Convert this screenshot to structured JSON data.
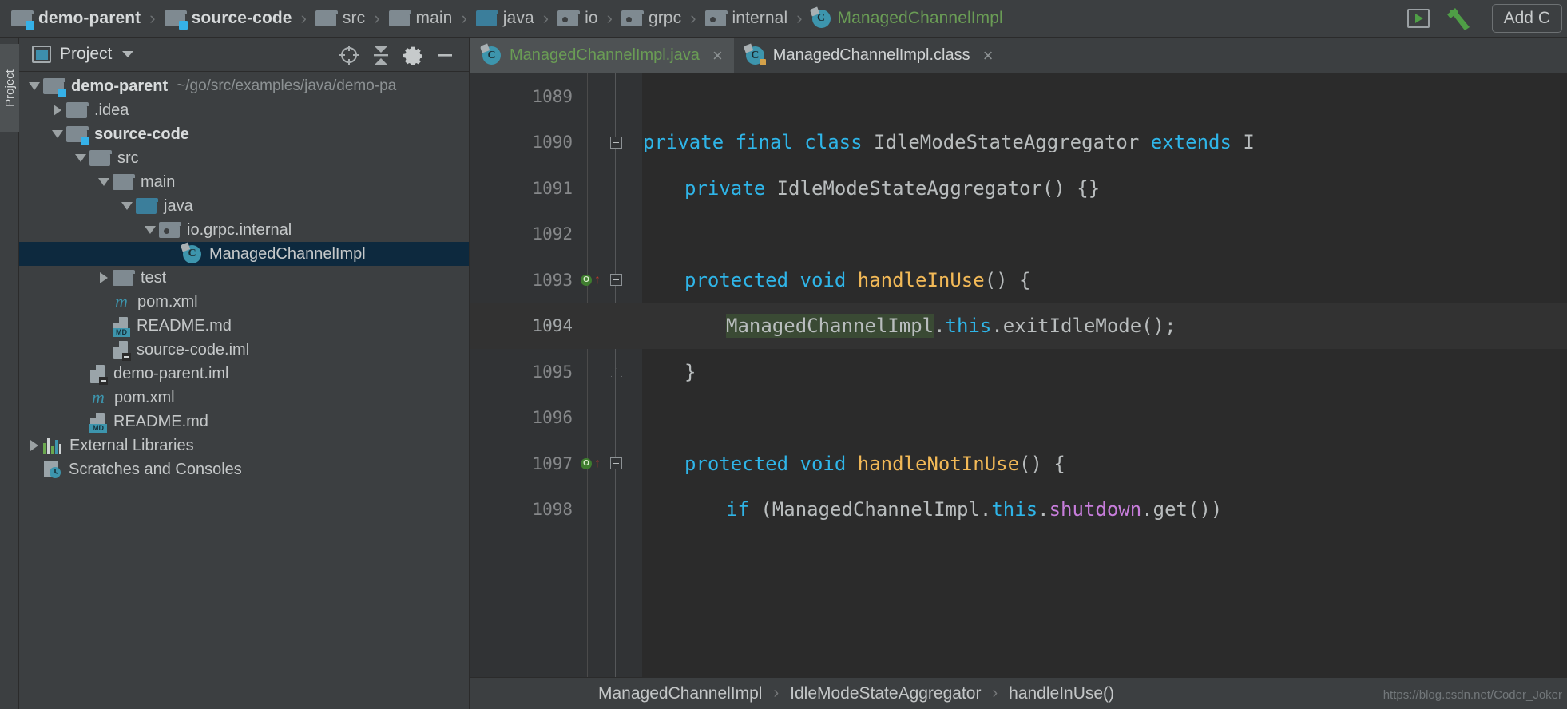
{
  "topbar": {
    "crumbs": [
      {
        "label": "demo-parent",
        "icon": "module-folder-icon",
        "bold": true,
        "green": false
      },
      {
        "label": "source-code",
        "icon": "module-folder-icon",
        "bold": true,
        "green": false
      },
      {
        "label": "src",
        "icon": "folder-icon",
        "bold": false,
        "green": false
      },
      {
        "label": "main",
        "icon": "folder-icon",
        "bold": false,
        "green": false
      },
      {
        "label": "java",
        "icon": "source-folder-icon",
        "bold": false,
        "green": false
      },
      {
        "label": "io",
        "icon": "package-icon",
        "bold": false,
        "green": false
      },
      {
        "label": "grpc",
        "icon": "package-icon",
        "bold": false,
        "green": false
      },
      {
        "label": "internal",
        "icon": "package-icon",
        "bold": false,
        "green": false
      },
      {
        "label": "ManagedChannelImpl",
        "icon": "java-class-icon",
        "bold": false,
        "green": true
      }
    ],
    "separator": "›",
    "run_button": "run-icon",
    "build_button": "hammer-build-icon",
    "add_configuration_label": "Add C"
  },
  "toolwindow_strip": {
    "project_tab": "Project"
  },
  "project_panel": {
    "title": "Project",
    "view_icon": "project-view-icon",
    "dropdown": "chevron-down-icon",
    "header_buttons": [
      {
        "name": "locate-file-icon",
        "glyph": "target"
      },
      {
        "name": "collapse-all-icon",
        "glyph": "collapse"
      },
      {
        "name": "settings-gear-icon",
        "glyph": "gear"
      },
      {
        "name": "hide-panel-icon",
        "glyph": "minus"
      }
    ],
    "tree": [
      {
        "label": "demo-parent",
        "sub": "~/go/src/examples/java/demo-pa",
        "icon": "module-folder-icon",
        "indent": 0,
        "twisty": "down",
        "bold": true,
        "selected": false
      },
      {
        "label": ".idea",
        "sub": "",
        "icon": "folder-icon",
        "indent": 1,
        "twisty": "right",
        "bold": false,
        "selected": false
      },
      {
        "label": "source-code",
        "sub": "",
        "icon": "module-folder-icon",
        "indent": 1,
        "twisty": "down",
        "bold": true,
        "selected": false
      },
      {
        "label": "src",
        "sub": "",
        "icon": "folder-icon",
        "indent": 2,
        "twisty": "down",
        "bold": false,
        "selected": false
      },
      {
        "label": "main",
        "sub": "",
        "icon": "folder-icon",
        "indent": 3,
        "twisty": "down",
        "bold": false,
        "selected": false
      },
      {
        "label": "java",
        "sub": "",
        "icon": "source-folder-icon",
        "indent": 4,
        "twisty": "down",
        "bold": false,
        "selected": false
      },
      {
        "label": "io.grpc.internal",
        "sub": "",
        "icon": "package-icon",
        "indent": 5,
        "twisty": "down",
        "bold": false,
        "selected": false
      },
      {
        "label": "ManagedChannelImpl",
        "sub": "",
        "icon": "java-class-icon",
        "indent": 6,
        "twisty": "none",
        "bold": false,
        "selected": true
      },
      {
        "label": "test",
        "sub": "",
        "icon": "folder-icon",
        "indent": 3,
        "twisty": "right",
        "bold": false,
        "selected": false
      },
      {
        "label": "pom.xml",
        "sub": "",
        "icon": "maven-icon",
        "indent": 3,
        "twisty": "none",
        "bold": false,
        "selected": false
      },
      {
        "label": "README.md",
        "sub": "",
        "icon": "markdown-icon",
        "indent": 3,
        "twisty": "none",
        "bold": false,
        "selected": false
      },
      {
        "label": "source-code.iml",
        "sub": "",
        "icon": "iml-file-icon",
        "indent": 3,
        "twisty": "none",
        "bold": false,
        "selected": false
      },
      {
        "label": "demo-parent.iml",
        "sub": "",
        "icon": "iml-file-icon",
        "indent": 2,
        "twisty": "none",
        "bold": false,
        "selected": false
      },
      {
        "label": "pom.xml",
        "sub": "",
        "icon": "maven-icon",
        "indent": 2,
        "twisty": "none",
        "bold": false,
        "selected": false
      },
      {
        "label": "README.md",
        "sub": "",
        "icon": "markdown-icon",
        "indent": 2,
        "twisty": "none",
        "bold": false,
        "selected": false
      },
      {
        "label": "External Libraries",
        "sub": "",
        "icon": "libraries-icon",
        "indent": 0,
        "twisty": "right",
        "bold": false,
        "selected": false
      },
      {
        "label": "Scratches and Consoles",
        "sub": "",
        "icon": "scratches-icon",
        "indent": 0,
        "twisty": "none",
        "bold": false,
        "selected": false
      }
    ]
  },
  "editor": {
    "tabs": [
      {
        "label": "ManagedChannelImpl.java",
        "icon": "java-class-icon",
        "active": true,
        "close": "×"
      },
      {
        "label": "ManagedChannelImpl.class",
        "icon": "java-class-locked-icon",
        "active": false,
        "close": "×"
      }
    ],
    "lines": [
      {
        "num": "1089",
        "marker": "",
        "fold": "none",
        "highlight": false,
        "tokens": []
      },
      {
        "num": "1090",
        "marker": "",
        "fold": "minus",
        "highlight": false,
        "tokens": [
          {
            "t": "private ",
            "c": "kw"
          },
          {
            "t": "final ",
            "c": "kw"
          },
          {
            "t": "class ",
            "c": "kw"
          },
          {
            "t": "IdleModeStateAggregator ",
            "c": "cls"
          },
          {
            "t": "extends ",
            "c": "kw"
          },
          {
            "t": "I",
            "c": "cls"
          }
        ],
        "indent": 0
      },
      {
        "num": "1091",
        "marker": "",
        "fold": "none",
        "highlight": false,
        "tokens": [
          {
            "t": "private ",
            "c": "kw"
          },
          {
            "t": "IdleModeStateAggregator() {}",
            "c": "pln"
          }
        ],
        "indent": 1
      },
      {
        "num": "1092",
        "marker": "",
        "fold": "none",
        "highlight": false,
        "tokens": [],
        "indent": 0
      },
      {
        "num": "1093",
        "marker": "override-up",
        "fold": "minus",
        "highlight": false,
        "tokens": [
          {
            "t": "protected ",
            "c": "kw"
          },
          {
            "t": "void ",
            "c": "kw"
          },
          {
            "t": "handleInUse",
            "c": "mth"
          },
          {
            "t": "() {",
            "c": "pln"
          }
        ],
        "indent": 1
      },
      {
        "num": "1094",
        "marker": "",
        "fold": "none",
        "highlight": true,
        "tokens": [
          {
            "t": "ManagedChannelImpl",
            "c": "cls hlbox"
          },
          {
            "t": ".",
            "c": "pln"
          },
          {
            "t": "this",
            "c": "kw"
          },
          {
            "t": ".exitIdleMode()",
            "c": "pln"
          },
          {
            "t": ";",
            "c": "sem"
          }
        ],
        "indent": 2
      },
      {
        "num": "1095",
        "marker": "",
        "fold": "tri-up",
        "highlight": false,
        "tokens": [
          {
            "t": "}",
            "c": "pln"
          }
        ],
        "indent": 1
      },
      {
        "num": "1096",
        "marker": "",
        "fold": "none",
        "highlight": false,
        "tokens": [],
        "indent": 0
      },
      {
        "num": "1097",
        "marker": "override-up",
        "fold": "minus",
        "highlight": false,
        "tokens": [
          {
            "t": "protected ",
            "c": "kw"
          },
          {
            "t": "void ",
            "c": "kw"
          },
          {
            "t": "handleNotInUse",
            "c": "mth"
          },
          {
            "t": "() {",
            "c": "pln"
          }
        ],
        "indent": 1
      },
      {
        "num": "1098",
        "marker": "",
        "fold": "none",
        "highlight": false,
        "tokens": [
          {
            "t": "if ",
            "c": "kw"
          },
          {
            "t": "(ManagedChannelImpl",
            "c": "pln"
          },
          {
            "t": ".",
            "c": "pln"
          },
          {
            "t": "this",
            "c": "kw"
          },
          {
            "t": ".",
            "c": "pln"
          },
          {
            "t": "shutdown",
            "c": "kw2"
          },
          {
            "t": ".get())",
            "c": "pln"
          }
        ],
        "indent": 2
      }
    ],
    "override_marker_letter": "O",
    "breadcrumb": [
      "ManagedChannelImpl",
      "IdleModeStateAggregator",
      "handleInUse()"
    ],
    "breadcrumb_separator": "›",
    "watermark": "https://blog.csdn.net/Coder_Joker"
  },
  "colors": {
    "panel_bg": "#3c3f41",
    "editor_bg": "#2b2b2b",
    "gutter_bg": "#313335",
    "selection_blue": "#0d293e",
    "accent_teal": "#3d95ad",
    "keyword_cyan": "#2fb5e8",
    "method_orange": "#f2b957",
    "green_text": "#6a9c55",
    "highlight_green": "#3a4a34"
  }
}
